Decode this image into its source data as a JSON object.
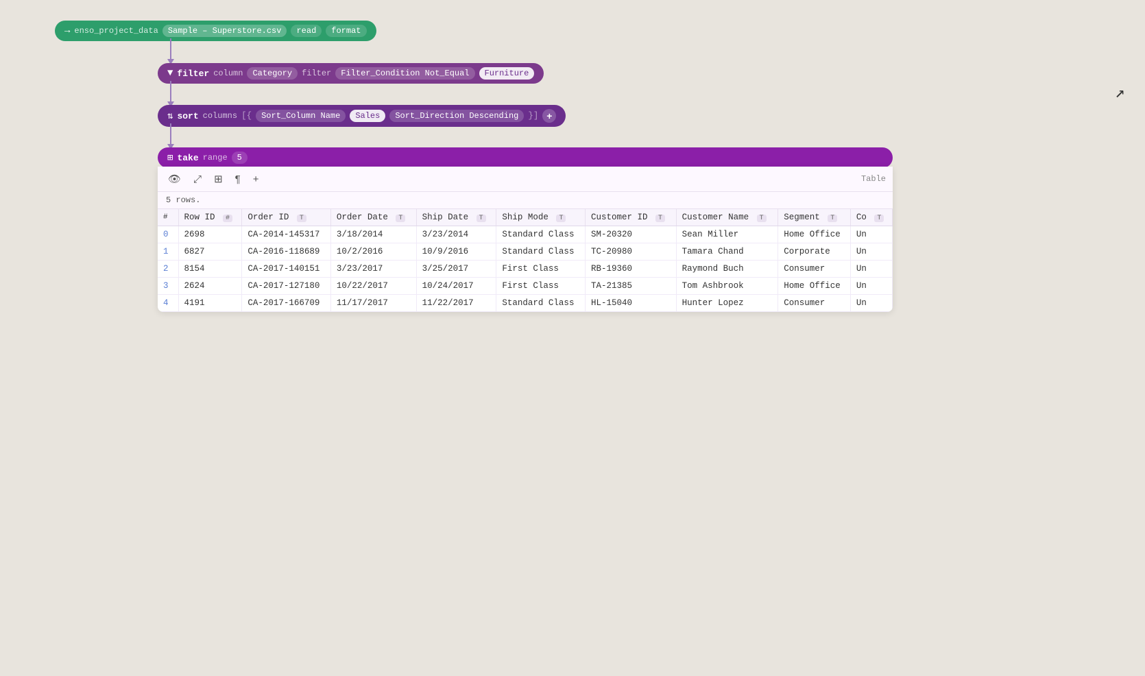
{
  "nodes": {
    "read": {
      "label": "enso_project_data",
      "file": "Sample – Superstore.csv",
      "actions": [
        "read",
        "format"
      ]
    },
    "filter": {
      "label": "filter",
      "column_param": "column",
      "column_value": "Category",
      "filter_param": "filter",
      "condition": "Filter_Condition Not_Equal",
      "value": "Furniture"
    },
    "sort": {
      "label": "sort",
      "columns_param": "columns",
      "sort_column": "Sort_Column Name",
      "sort_value": "Sales",
      "direction": "Sort_Direction Descending"
    },
    "take": {
      "label": "take",
      "range_param": "range",
      "range_value": "5"
    }
  },
  "table": {
    "label": "Table",
    "row_count": "5 rows.",
    "columns": [
      {
        "name": "#",
        "type": ""
      },
      {
        "name": "Row ID",
        "type": "#"
      },
      {
        "name": "Order ID",
        "type": "T"
      },
      {
        "name": "Order Date",
        "type": "T"
      },
      {
        "name": "Ship Date",
        "type": "T"
      },
      {
        "name": "Ship Mode",
        "type": "T"
      },
      {
        "name": "Customer ID",
        "type": "T"
      },
      {
        "name": "Customer Name",
        "type": "T"
      },
      {
        "name": "Segment",
        "type": "T"
      },
      {
        "name": "Co",
        "type": "T"
      }
    ],
    "rows": [
      {
        "index": "0",
        "row_id": "2698",
        "order_id": "CA-2014-145317",
        "order_date": "3/18/2014",
        "ship_date": "3/23/2014",
        "ship_mode": "Standard Class",
        "customer_id": "SM-20320",
        "customer_name": "Sean Miller",
        "segment": "Home Office",
        "col": "Un"
      },
      {
        "index": "1",
        "row_id": "6827",
        "order_id": "CA-2016-118689",
        "order_date": "10/2/2016",
        "ship_date": "10/9/2016",
        "ship_mode": "Standard Class",
        "customer_id": "TC-20980",
        "customer_name": "Tamara Chand",
        "segment": "Corporate",
        "col": "Un"
      },
      {
        "index": "2",
        "row_id": "8154",
        "order_id": "CA-2017-140151",
        "order_date": "3/23/2017",
        "ship_date": "3/25/2017",
        "ship_mode": "First Class",
        "customer_id": "RB-19360",
        "customer_name": "Raymond Buch",
        "segment": "Consumer",
        "col": "Un"
      },
      {
        "index": "3",
        "row_id": "2624",
        "order_id": "CA-2017-127180",
        "order_date": "10/22/2017",
        "ship_date": "10/24/2017",
        "ship_mode": "First Class",
        "customer_id": "TA-21385",
        "customer_name": "Tom Ashbrook",
        "segment": "Home Office",
        "col": "Un"
      },
      {
        "index": "4",
        "row_id": "4191",
        "order_id": "CA-2017-166709",
        "order_date": "11/17/2017",
        "ship_date": "11/22/2017",
        "ship_mode": "Standard Class",
        "customer_id": "HL-15040",
        "customer_name": "Hunter Lopez",
        "segment": "Consumer",
        "col": "Un"
      }
    ],
    "toolbar": {
      "eye_icon": "👁",
      "expand_icon": "⤢",
      "grid_icon": "⊞",
      "text_icon": "¶",
      "plus_icon": "+"
    }
  }
}
